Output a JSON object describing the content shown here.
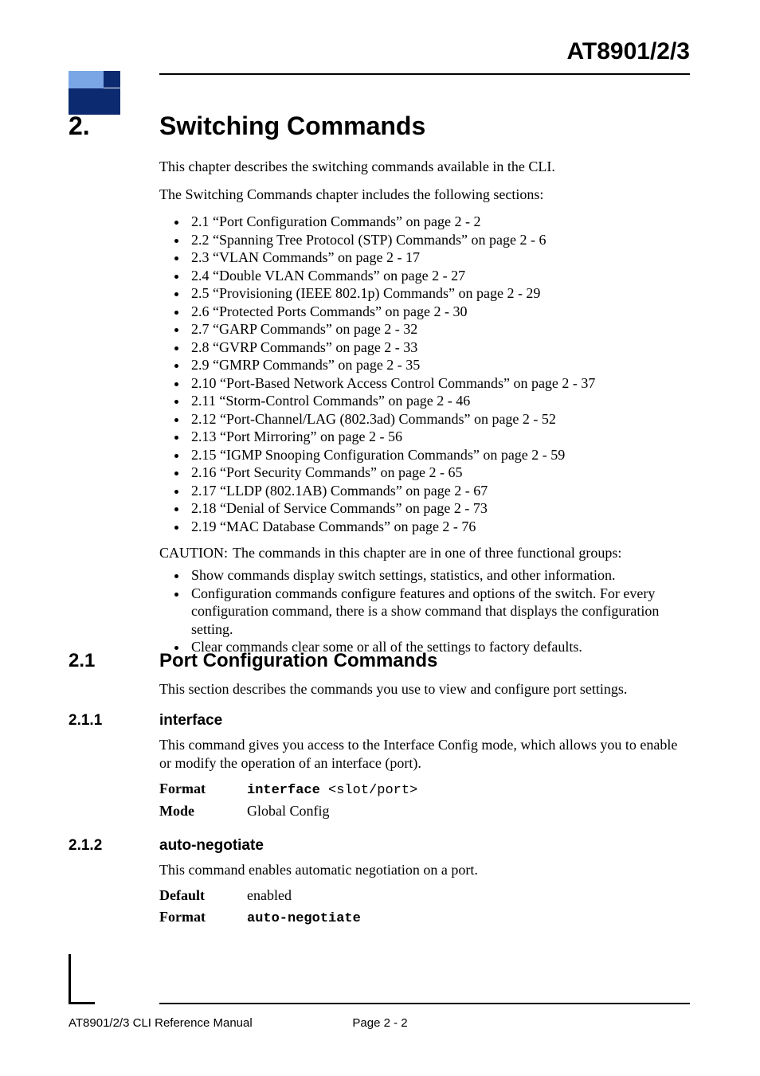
{
  "header": {
    "product": "AT8901/2/3"
  },
  "chapter": {
    "num": "2.",
    "title": "Switching Commands"
  },
  "intro": {
    "p1": "This chapter describes the switching commands available in the CLI.",
    "p2": "The Switching Commands chapter includes the following sections:"
  },
  "toc": [
    "2.1 “Port Configuration Commands” on page 2 - 2",
    "2.2 “Spanning Tree Protocol (STP) Commands” on page 2 - 6",
    "2.3 “VLAN Commands” on page 2 - 17",
    "2.4 “Double VLAN Commands” on page 2 - 27",
    "2.5 “Provisioning (IEEE 802.1p) Commands” on page 2 - 29",
    "2.6 “Protected Ports Commands” on page 2 - 30",
    "2.7 “GARP Commands” on page 2 - 32",
    "2.8 “GVRP Commands” on page 2 - 33",
    "2.9 “GMRP Commands” on page 2 - 35",
    "2.10 “Port-Based Network Access Control Commands” on page 2 - 37",
    "2.11 “Storm-Control Commands” on page 2 - 46",
    "2.12 “Port-Channel/LAG (802.3ad) Commands” on page 2 - 52",
    "2.13 “Port Mirroring” on page 2 - 56",
    "2.15 “IGMP Snooping Configuration Commands” on page 2 - 59",
    "2.16 “Port Security Commands” on page 2 - 65",
    "2.17 “LLDP (802.1AB) Commands” on page 2 - 67",
    "2.18 “Denial of Service Commands” on page 2 - 73",
    "2.19 “MAC Database Commands” on page 2 - 76"
  ],
  "caution": {
    "label": "CAUTION:",
    "text": "The commands in this chapter are in one of three functional groups:"
  },
  "groups": [
    "Show commands display switch settings, statistics, and other information.",
    "Configuration commands configure features and options of the switch. For every configuration command, there is a show command that displays the configuration setting.",
    "Clear commands clear some or all of the settings to factory defaults."
  ],
  "s21": {
    "num": "2.1",
    "title": "Port Configuration Commands",
    "p": "This section describes the commands you use to view and configure port settings."
  },
  "s211": {
    "num": "2.1.1",
    "title": "interface",
    "p": "This command gives you access to the Interface Config mode, which allows you to enable or modify the operation of an interface (port).",
    "kv": {
      "format_label": "Format",
      "format_cmd": "interface ",
      "format_arg": "<slot/port>",
      "mode_label": "Mode",
      "mode_val": "Global Config"
    }
  },
  "s212": {
    "num": "2.1.2",
    "title": "auto-negotiate",
    "p": "This command enables automatic negotiation on a port.",
    "kv": {
      "default_label": "Default",
      "default_val": "enabled",
      "format_label": "Format",
      "format_cmd": "auto-negotiate"
    }
  },
  "footer": {
    "left": "AT8901/2/3 CLI Reference Manual",
    "center": "Page 2 - 2"
  }
}
